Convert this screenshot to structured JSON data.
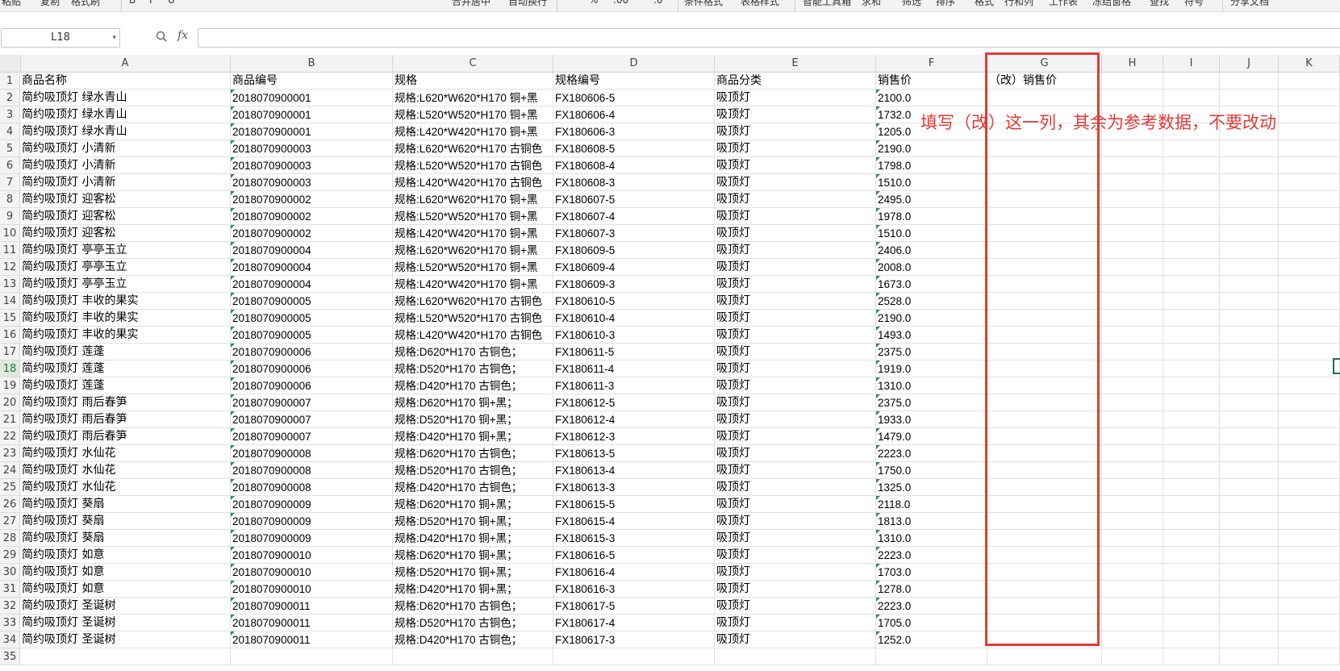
{
  "toolbar": {
    "items": [
      "粘贴",
      "复制",
      "格式刷",
      "B",
      "I",
      "U",
      "合并居中",
      "自动换行",
      "%",
      ".00",
      ".0",
      "条件格式",
      "表格样式",
      "智能工具箱",
      "求和",
      "筛选",
      "排序",
      "格式",
      "行和列",
      "工作表",
      "冻结窗格",
      "查找",
      "符号",
      "分享文档"
    ]
  },
  "formula_bar": {
    "cell_ref": "L18",
    "fx": "fx",
    "formula": ""
  },
  "columns": [
    "A",
    "B",
    "C",
    "D",
    "E",
    "F",
    "G",
    "H",
    "I",
    "J",
    "K"
  ],
  "row_numbers": [
    "1",
    "2",
    "3",
    "4",
    "5",
    "6",
    "7",
    "8",
    "9",
    "10",
    "11",
    "12",
    "13",
    "14",
    "15",
    "16",
    "17",
    "18",
    "19",
    "20",
    "21",
    "22",
    "23",
    "24",
    "25",
    "26",
    "27",
    "28",
    "29",
    "30",
    "31",
    "32",
    "33",
    "34",
    "35"
  ],
  "active_row": "18",
  "header": {
    "name": "商品名称",
    "code": "商品编号",
    "spec": "规格",
    "spec_code": "规格编号",
    "category": "商品分类",
    "price": "销售价",
    "new_price": "（改）销售价"
  },
  "rows": [
    {
      "name": "简约吸顶灯 绿水青山",
      "code": "2018070900001",
      "spec": "规格:L620*W620*H170 铜+黑",
      "spec_code": "FX180606-5",
      "category": "吸顶灯",
      "price": "2100.0"
    },
    {
      "name": "简约吸顶灯 绿水青山",
      "code": "2018070900001",
      "spec": "规格:L520*W520*H170 铜+黑",
      "spec_code": "FX180606-4",
      "category": "吸顶灯",
      "price": "1732.0"
    },
    {
      "name": "简约吸顶灯 绿水青山",
      "code": "2018070900001",
      "spec": "规格:L420*W420*H170 铜+黑",
      "spec_code": "FX180606-3",
      "category": "吸顶灯",
      "price": "1205.0"
    },
    {
      "name": "简约吸顶灯 小清新",
      "code": "2018070900003",
      "spec": "规格:L620*W620*H170 古铜色",
      "spec_code": "FX180608-5",
      "category": "吸顶灯",
      "price": "2190.0"
    },
    {
      "name": "简约吸顶灯 小清新",
      "code": "2018070900003",
      "spec": "规格:L520*W520*H170 古铜色",
      "spec_code": "FX180608-4",
      "category": "吸顶灯",
      "price": "1798.0"
    },
    {
      "name": "简约吸顶灯 小清新",
      "code": "2018070900003",
      "spec": "规格:L420*W420*H170 古铜色",
      "spec_code": "FX180608-3",
      "category": "吸顶灯",
      "price": "1510.0"
    },
    {
      "name": "简约吸顶灯 迎客松",
      "code": "2018070900002",
      "spec": "规格:L620*W620*H170 铜+黑",
      "spec_code": "FX180607-5",
      "category": "吸顶灯",
      "price": "2495.0"
    },
    {
      "name": "简约吸顶灯 迎客松",
      "code": "2018070900002",
      "spec": "规格:L520*W520*H170 铜+黑",
      "spec_code": "FX180607-4",
      "category": "吸顶灯",
      "price": "1978.0"
    },
    {
      "name": "简约吸顶灯 迎客松",
      "code": "2018070900002",
      "spec": "规格:L420*W420*H170 铜+黑",
      "spec_code": "FX180607-3",
      "category": "吸顶灯",
      "price": "1510.0"
    },
    {
      "name": "简约吸顶灯  亭亭玉立",
      "code": "2018070900004",
      "spec": "规格:L620*W620*H170 铜+黑",
      "spec_code": "FX180609-5",
      "category": "吸顶灯",
      "price": "2406.0"
    },
    {
      "name": "简约吸顶灯  亭亭玉立",
      "code": "2018070900004",
      "spec": "规格:L520*W520*H170 铜+黑",
      "spec_code": "FX180609-4",
      "category": "吸顶灯",
      "price": "2008.0"
    },
    {
      "name": "简约吸顶灯  亭亭玉立",
      "code": "2018070900004",
      "spec": "规格:L420*W420*H170 铜+黑",
      "spec_code": "FX180609-3",
      "category": "吸顶灯",
      "price": "1673.0"
    },
    {
      "name": "简约吸顶灯 丰收的果实",
      "code": "2018070900005",
      "spec": "规格:L620*W620*H170 古铜色",
      "spec_code": "FX180610-5",
      "category": "吸顶灯",
      "price": "2528.0"
    },
    {
      "name": "简约吸顶灯 丰收的果实",
      "code": "2018070900005",
      "spec": "规格:L520*W520*H170 古铜色",
      "spec_code": "FX180610-4",
      "category": "吸顶灯",
      "price": "2190.0"
    },
    {
      "name": "简约吸顶灯 丰收的果实",
      "code": "2018070900005",
      "spec": "规格:L420*W420*H170 古铜色",
      "spec_code": "FX180610-3",
      "category": "吸顶灯",
      "price": "1493.0"
    },
    {
      "name": "简约吸顶灯 莲蓬",
      "code": "2018070900006",
      "spec": "规格:D620*H170 古铜色；",
      "spec_code": "FX180611-5",
      "category": "吸顶灯",
      "price": "2375.0"
    },
    {
      "name": "简约吸顶灯 莲蓬",
      "code": "2018070900006",
      "spec": "规格:D520*H170 古铜色；",
      "spec_code": "FX180611-4",
      "category": "吸顶灯",
      "price": "1919.0"
    },
    {
      "name": "简约吸顶灯 莲蓬",
      "code": "2018070900006",
      "spec": "规格:D420*H170 古铜色；",
      "spec_code": "FX180611-3",
      "category": "吸顶灯",
      "price": "1310.0"
    },
    {
      "name": "简约吸顶灯  雨后春笋",
      "code": "2018070900007",
      "spec": "规格:D620*H170 铜+黑；",
      "spec_code": "FX180612-5",
      "category": "吸顶灯",
      "price": "2375.0"
    },
    {
      "name": "简约吸顶灯  雨后春笋",
      "code": "2018070900007",
      "spec": "规格:D520*H170 铜+黑；",
      "spec_code": "FX180612-4",
      "category": "吸顶灯",
      "price": "1933.0"
    },
    {
      "name": "简约吸顶灯  雨后春笋",
      "code": "2018070900007",
      "spec": "规格:D420*H170 铜+黑；",
      "spec_code": "FX180612-3",
      "category": "吸顶灯",
      "price": "1479.0"
    },
    {
      "name": "简约吸顶灯 水仙花",
      "code": "2018070900008",
      "spec": "规格:D620*H170 古铜色；",
      "spec_code": "FX180613-5",
      "category": "吸顶灯",
      "price": "2223.0"
    },
    {
      "name": "简约吸顶灯 水仙花",
      "code": "2018070900008",
      "spec": "规格:D520*H170 古铜色；",
      "spec_code": "FX180613-4",
      "category": "吸顶灯",
      "price": "1750.0"
    },
    {
      "name": "简约吸顶灯 水仙花",
      "code": "2018070900008",
      "spec": "规格:D420*H170 古铜色；",
      "spec_code": "FX180613-3",
      "category": "吸顶灯",
      "price": "1325.0"
    },
    {
      "name": "简约吸顶灯 葵扇",
      "code": "2018070900009",
      "spec": "规格:D620*H170 铜+黑；",
      "spec_code": "FX180615-5",
      "category": "吸顶灯",
      "price": "2118.0"
    },
    {
      "name": "简约吸顶灯 葵扇",
      "code": "2018070900009",
      "spec": "规格:D520*H170 铜+黑；",
      "spec_code": "FX180615-4",
      "category": "吸顶灯",
      "price": "1813.0"
    },
    {
      "name": "简约吸顶灯 葵扇",
      "code": "2018070900009",
      "spec": "规格:D420*H170 铜+黑；",
      "spec_code": "FX180615-3",
      "category": "吸顶灯",
      "price": "1310.0"
    },
    {
      "name": "简约吸顶灯  如意",
      "code": "2018070900010",
      "spec": "规格:D620*H170 铜+黑；",
      "spec_code": "FX180616-5",
      "category": "吸顶灯",
      "price": "2223.0"
    },
    {
      "name": "简约吸顶灯  如意",
      "code": "2018070900010",
      "spec": "规格:D520*H170 铜+黑；",
      "spec_code": "FX180616-4",
      "category": "吸顶灯",
      "price": "1703.0"
    },
    {
      "name": "简约吸顶灯  如意",
      "code": "2018070900010",
      "spec": "规格:D420*H170 铜+黑；",
      "spec_code": "FX180616-3",
      "category": "吸顶灯",
      "price": "1278.0"
    },
    {
      "name": "简约吸顶灯  圣诞树",
      "code": "2018070900011",
      "spec": "规格:D620*H170 古铜色；",
      "spec_code": "FX180617-5",
      "category": "吸顶灯",
      "price": "2223.0"
    },
    {
      "name": "简约吸顶灯  圣诞树",
      "code": "2018070900011",
      "spec": "规格:D520*H170 古铜色；",
      "spec_code": "FX180617-4",
      "category": "吸顶灯",
      "price": "1705.0"
    },
    {
      "name": "简约吸顶灯  圣诞树",
      "code": "2018070900011",
      "spec": "规格:D420*H170 古铜色；",
      "spec_code": "FX180617-3",
      "category": "吸顶灯",
      "price": "1252.0"
    }
  ],
  "annotation": "填写（改）这一列，其余为参考数据，不要改动",
  "colors": {
    "annotation": "#e53935",
    "highlight_box": "#e53935",
    "selection": "#217346"
  }
}
